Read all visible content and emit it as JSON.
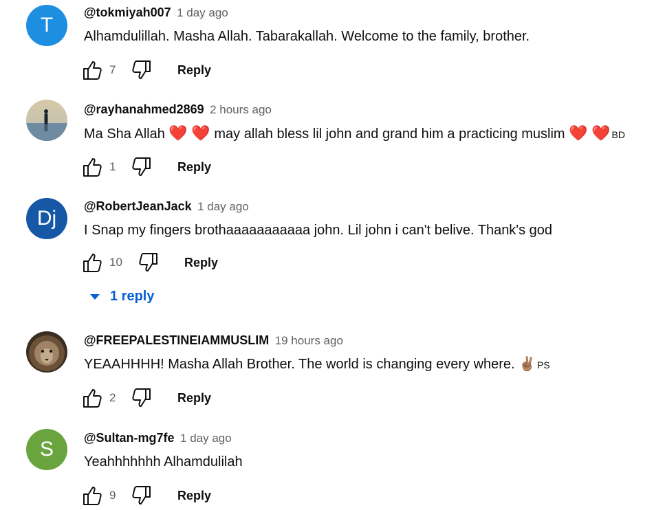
{
  "comments": [
    {
      "author": "@tokmiyah007",
      "time": "1 day ago",
      "avatar_letter": "T",
      "avatar_color": "#1e8fe0",
      "text": "Alhamdulillah. Masha Allah. Tabarakallah. Welcome to the family, brother.",
      "likes": "7",
      "reply_label": "Reply"
    },
    {
      "author": "@rayhanahmed2869",
      "time": "2 hours ago",
      "text_parts": [
        "Ma Sha Allah",
        "may allah bless lil john and grand him a practicing muslim"
      ],
      "heart": "❤️",
      "flag": "BD",
      "likes": "1",
      "reply_label": "Reply"
    },
    {
      "author": "@RobertJeanJack",
      "time": "1 day ago",
      "avatar_letter": "Dj",
      "avatar_color": "#1658a6",
      "text": "I Snap my fingers brothaaaaaaaaaaa john. Lil john i can't belive. Thank's god",
      "likes": "10",
      "reply_label": "Reply",
      "replies_label": "1 reply"
    },
    {
      "author": "@FREEPALESTINEIAMMUSLIM",
      "time": "19 hours ago",
      "text": "YEAAHHHH! Masha Allah Brother.  The world is changing every where.",
      "emoji": "✌🏽",
      "flag": "PS",
      "likes": "2",
      "reply_label": "Reply"
    },
    {
      "author": "@Sultan-mg7fe",
      "time": "1 day ago",
      "avatar_letter": "S",
      "avatar_color": "#6aa43f",
      "text": "Yeahhhhhhh Alhamdulilah",
      "likes": "9",
      "reply_label": "Reply"
    }
  ]
}
